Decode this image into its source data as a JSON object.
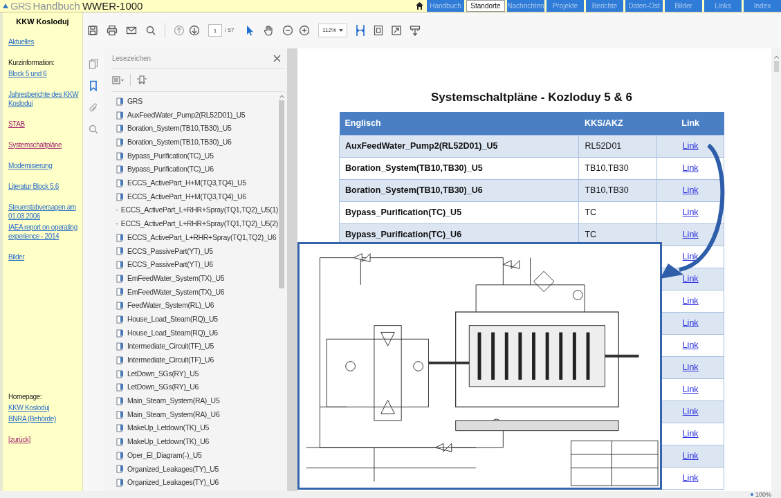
{
  "header": {
    "logo": "GRS",
    "title": "Handbuch",
    "subtitle": "WWER-1000",
    "nav": [
      {
        "label": "Handbuch",
        "selected": false
      },
      {
        "label": "Standorte",
        "selected": true
      },
      {
        "label": "Nachrichten",
        "selected": false
      },
      {
        "label": "Projekte",
        "selected": false
      },
      {
        "label": "Berichte",
        "selected": false
      },
      {
        "label": "Daten-Ost",
        "selected": false
      },
      {
        "label": "Bilder",
        "selected": false
      },
      {
        "label": "Links",
        "selected": false
      },
      {
        "label": "Index",
        "selected": false
      }
    ]
  },
  "sidebar": {
    "title": "KKW Kosloduj",
    "sections": [
      [
        {
          "kind": "link",
          "text": "Aktuelles",
          "visited": false
        }
      ],
      [
        {
          "kind": "label",
          "text": "Kurzinformation:"
        },
        {
          "kind": "link",
          "text": "Block 5 und 6",
          "visited": false
        }
      ],
      [
        {
          "kind": "link",
          "text": "Jahresberichte des KKW Kosloduj",
          "visited": false
        }
      ],
      [
        {
          "kind": "link",
          "text": "STAB",
          "visited": true
        }
      ],
      [
        {
          "kind": "link",
          "text": "Systemschaltpläne",
          "visited": true
        }
      ],
      [
        {
          "kind": "link",
          "text": "Modernisierung",
          "visited": false
        }
      ],
      [
        {
          "kind": "link",
          "text": "Literatur Block 5.6",
          "visited": false
        }
      ],
      [
        {
          "kind": "link",
          "text": "Steuerstabversagen am 01.03.2006",
          "visited": false
        },
        {
          "kind": "link",
          "text": "IAEA report on operating experience - 2014",
          "visited": false
        }
      ],
      [
        {
          "kind": "link",
          "text": "Bilder",
          "visited": false
        }
      ]
    ],
    "bottom_sections": [
      [
        {
          "kind": "label",
          "text": "Homepage:"
        },
        {
          "kind": "link",
          "text": "KKW Kosloduj",
          "visited": false
        },
        {
          "kind": "link",
          "text": "BNRA (Behörde)",
          "visited": false
        }
      ],
      [
        {
          "kind": "link",
          "text": "[zurück]",
          "visited": true
        }
      ]
    ]
  },
  "pdf_toolbar": {
    "page": "1",
    "page_total": "/ 57",
    "zoom": "112%"
  },
  "bookmarks": {
    "title": "Lesezeichen",
    "items": [
      "GRS",
      "AuxFeedWater_Pump2(RL52D01)_U5",
      "Boration_System(TB10,TB30)_U5",
      "Boration_System(TB10,TB30)_U6",
      "Bypass_Purification(TC)_U5",
      "Bypass_Purification(TC)_U6",
      "ECCS_ActivePart_H+M(TQ3,TQ4)_U5",
      "ECCS_ActivePart_H+M(TQ3,TQ4)_U6",
      "ECCS_ActivePart_L+RHR+Spray(TQ1,TQ2)_U5(1)",
      "ECCS_ActivePart_L+RHR+Spray(TQ1,TQ2)_U5(2)",
      "ECCS_ActivePart_L+RHR+Spray(TQ1,TQ2)_U6",
      "ECCS_PassivePart(YT)_U5",
      "ECCS_PassivePart(YT)_U6",
      "EmFeedWater_System(TX)_U5",
      "EmFeedWater_System(TX)_U6",
      "FeedWater_System(RL)_U6",
      "House_Load_Steam(RQ)_U5",
      "House_Load_Steam(RQ)_U6",
      "Intermediate_Circuit(TF)_U5",
      "Intermediate_Circuit(TF)_U6",
      "LetDown_SGs(RY)_U5",
      "LetDown_SGs(RY)_U6",
      "Main_Steam_System(RA)_U5",
      "Main_Steam_System(RA)_U6",
      "MakeUp_Letdown(TK)_U5",
      "MakeUp_Letdown(TK)_U6",
      "Oper_El_Diagram(-)_U5",
      "Organized_Leakages(TY)_U5",
      "Organized_Leakages(TY)_U6"
    ]
  },
  "document": {
    "title": "Systemschaltpläne - Kozloduy 5 & 6",
    "table": {
      "columns": [
        "Englisch",
        "KKS/AKZ",
        "Link"
      ],
      "rows": [
        {
          "name": "AuxFeedWater_Pump2(RL52D01)_U5",
          "kks": "RL52D01",
          "link": "Link"
        },
        {
          "name": "Boration_System(TB10,TB30)_U5",
          "kks": "TB10,TB30",
          "link": "Link"
        },
        {
          "name": "Boration_System(TB10,TB30)_U6",
          "kks": "TB10,TB30",
          "link": "Link"
        },
        {
          "name": "Bypass_Purification(TC)_U5",
          "kks": "TC",
          "link": "Link"
        },
        {
          "name": "Bypass_Purification(TC)_U6",
          "kks": "TC",
          "link": "Link"
        },
        {
          "link": "Link"
        },
        {
          "link": "Link"
        },
        {
          "link": "Link"
        },
        {
          "link": "Link"
        },
        {
          "link": "Link"
        },
        {
          "link": "Link"
        },
        {
          "link": "Link"
        },
        {
          "link": "Link"
        },
        {
          "link": "Link"
        },
        {
          "link": "Link"
        },
        {
          "link": "Link"
        }
      ]
    }
  },
  "status_bar": {
    "zoom": "100%"
  }
}
